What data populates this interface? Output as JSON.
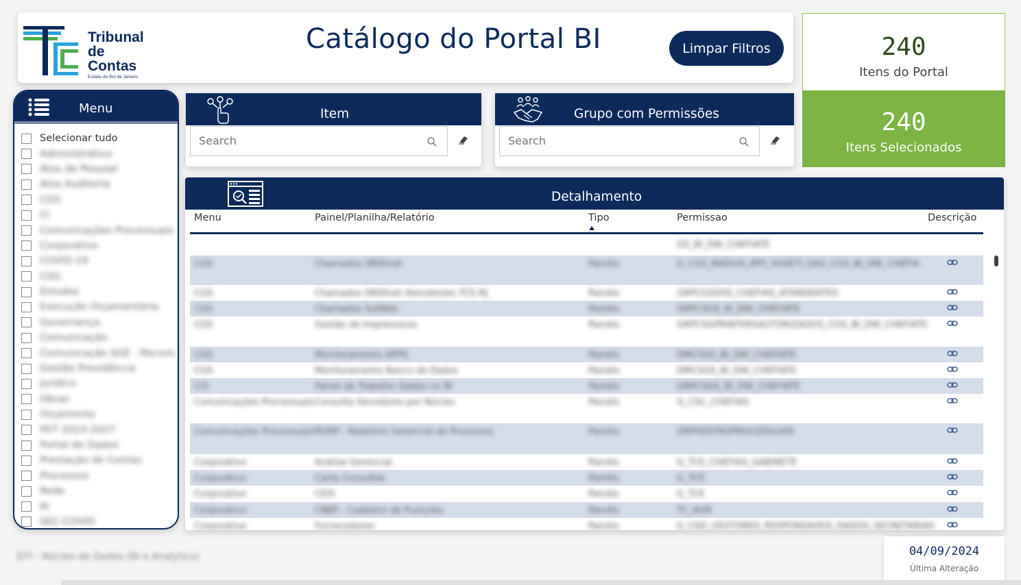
{
  "header": {
    "logo": {
      "line1": "Tribunal",
      "line2": "de Contas",
      "line3": "Estado do Rio de Janeiro"
    },
    "title": "Catálogo do Portal BI",
    "clear_button": "Limpar Filtros"
  },
  "kpis": {
    "total": {
      "value": "240",
      "label": "Itens do Portal"
    },
    "selected": {
      "value": "240",
      "label": "Itens Selecionados"
    }
  },
  "menu": {
    "title": "Menu",
    "select_all": "Selecionar tudo",
    "items": [
      "Administrativo",
      "Atos de Pessoal",
      "Atos Auditoria",
      "CGS",
      "CI",
      "Comunicações Processuais",
      "Corporativo",
      "COVID-19",
      "CSG",
      "Estudos",
      "Execução Orçamentária",
      "Governança",
      "Comunicação",
      "Comunicação SGE - Recom...",
      "Gestão Previdência",
      "Jurídico",
      "Obras",
      "Orçamento",
      "PET 2023-2027",
      "Portal de Dados",
      "Prestação de Contas",
      "Processos",
      "Rede",
      "RI",
      "SEC-COVID"
    ]
  },
  "slicers": {
    "item": {
      "title": "Item",
      "placeholder": "Search"
    },
    "group": {
      "title": "Grupo com Permissões",
      "placeholder": "Search"
    }
  },
  "table": {
    "title": "Detalhamento",
    "columns": [
      "Menu",
      "Painel/Planilha/Relatório",
      "Tipo",
      "Permissao",
      "Descrição"
    ],
    "sorted_column": "Tipo",
    "rows": [
      {
        "menu": "",
        "item": "",
        "tipo": "",
        "perm": "GS_BI_DW_CHEFIATE",
        "h": 28,
        "alt": false,
        "link": false
      },
      {
        "menu": "CGS",
        "item": "Chamados 0800net",
        "tipo": "Painéis",
        "perm": "G_CGS_RADIUS_APS_SSGETI_DAS_CGS_BI_DW_CHEFIA",
        "h": 43,
        "alt": true,
        "link": true
      },
      {
        "menu": "CGS",
        "item": "Chamados 0800net Atendentes TCE-RJ",
        "tipo": "Painéis",
        "perm": "GRPCGSDSS_CHEFIAS_ATENDENTES",
        "h": 23,
        "alt": false,
        "link": true
      },
      {
        "menu": "CGS",
        "item": "Chamados SulWeb",
        "tipo": "Painéis",
        "perm": "GRPCSGS_BI_DW_CHEFIATE",
        "h": 23,
        "alt": true,
        "link": true
      },
      {
        "menu": "CGS",
        "item": "Gestão de Impressoras",
        "tipo": "Painéis",
        "perm": "GRPCSGPRINTERSAUTORIZADOS_CGS_BI_DW_CHEFIATE",
        "h": 44,
        "alt": false,
        "link": true
      },
      {
        "menu": "CGS",
        "item": "Monitoramento APPS",
        "tipo": "Painéis",
        "perm": "DMCSGS_BI_DW_CHEFIATE",
        "h": 23,
        "alt": true,
        "link": true
      },
      {
        "menu": "CGS",
        "item": "Monitoramento Banco de Dados",
        "tipo": "Painéis",
        "perm": "DMCSGS_BI_DW_CHEFIATE",
        "h": 23,
        "alt": false,
        "link": true
      },
      {
        "menu": "CIS",
        "item": "Painel de Trabalho Dados no BI",
        "tipo": "Painéis",
        "perm": "GRPCSGS_BI_DW_CHEFIATE",
        "h": 23,
        "alt": true,
        "link": true
      },
      {
        "menu": "Comunicações Processuais",
        "item": "Consulta Servidores por Núcleo",
        "tipo": "Painéis",
        "perm": "G_CSC_CHEFIAS",
        "h": 43,
        "alt": false,
        "link": true
      },
      {
        "menu": "Comunicações Processuais",
        "item": "RGRP - Relatório Gerencial de Processos",
        "tipo": "Painéis",
        "perm": "GRPGESTAOPROCESSUAIS",
        "h": 45,
        "alt": true,
        "link": true
      },
      {
        "menu": "Corporativo",
        "item": "Análise Gerencial",
        "tipo": "Painéis",
        "perm": "G_TCE_CHEFIAS_GABINETE",
        "h": 23,
        "alt": false,
        "link": true
      },
      {
        "menu": "Corporativo",
        "item": "Carta Consultas",
        "tipo": "Painéis",
        "perm": "G_TCE",
        "h": 23,
        "alt": true,
        "link": true
      },
      {
        "menu": "Corporativo",
        "item": "CEIS",
        "tipo": "Painéis",
        "perm": "G_TCE",
        "h": 24,
        "alt": false,
        "link": true
      },
      {
        "menu": "Corporativo",
        "item": "CNEP - Cadastro de Punições",
        "tipo": "Painéis",
        "perm": "TC_AUD",
        "h": 23,
        "alt": true,
        "link": true
      },
      {
        "menu": "Corporativo",
        "item": "Fornecedores",
        "tipo": "Painéis",
        "perm": "G_CAD_GESTORES_RESPONSAVEIS_DADOS_SECRETARIAS",
        "h": 23,
        "alt": false,
        "link": true
      }
    ]
  },
  "footer": {
    "left_note": "DTI - Núcleo de Dados (BI e Analytics)",
    "date": "04/09/2024",
    "date_label": "Última Alteração"
  },
  "colors": {
    "navy": "#0d2a5b",
    "green": "#7cb342",
    "row_alt": "#d5dcea",
    "logo_green": "#4caf50",
    "logo_blue": "#29a3db"
  }
}
